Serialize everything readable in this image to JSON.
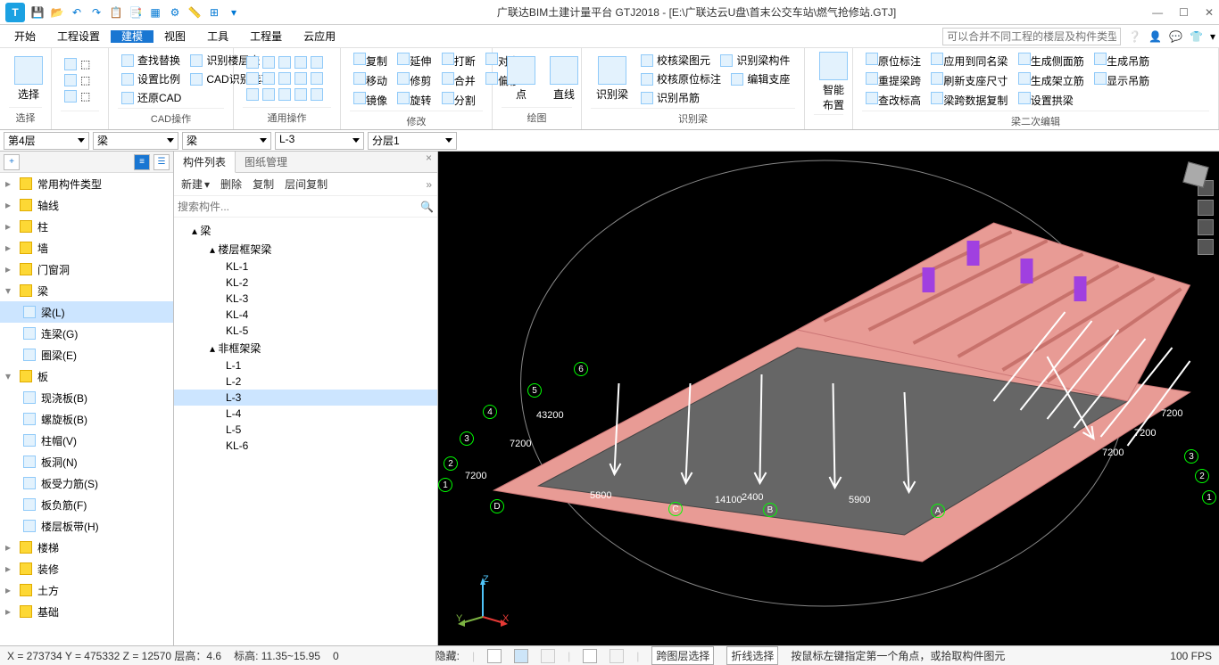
{
  "title": "广联达BIM土建计量平台 GTJ2018 - [E:\\广联达云U盘\\首末公交车站\\燃气抢修站.GTJ]",
  "logo": "T",
  "menu_tabs": [
    "开始",
    "工程设置",
    "建模",
    "视图",
    "工具",
    "工程量",
    "云应用"
  ],
  "menu_active": 2,
  "search_placeholder": "可以合并不同工程的楼层及构件类型吗？",
  "ribbon": {
    "g1": {
      "label": "选择",
      "btns": [
        "选择"
      ]
    },
    "g2": {
      "label": "CAD操作",
      "items": [
        "查找替换",
        "识别楼层表",
        "设置比例",
        "CAD识别选项",
        "还原CAD"
      ]
    },
    "g3": {
      "label": "通用操作"
    },
    "g4": {
      "label": "修改",
      "items": [
        "复制",
        "延伸",
        "打断",
        "对齐",
        "移动",
        "修剪",
        "合并",
        "偏移",
        "镜像",
        "旋转",
        "分割"
      ]
    },
    "g5": {
      "label": "绘图",
      "items": [
        "点",
        "直线"
      ]
    },
    "g6": {
      "label": "识别梁",
      "big": "识别梁",
      "items": [
        "校核梁图元",
        "识别梁构件",
        "校核原位标注",
        "编辑支座",
        "识别吊筋"
      ]
    },
    "g7": {
      "label": "",
      "big": "智能布置"
    },
    "g8": {
      "label": "梁二次编辑",
      "items": [
        "原位标注",
        "应用到同名梁",
        "生成侧面筋",
        "生成吊筋",
        "重提梁跨",
        "刷新支座尺寸",
        "生成架立筋",
        "显示吊筋",
        "查改标高",
        "梁跨数据复制",
        "设置拱梁"
      ]
    }
  },
  "filters": [
    "第4层",
    "梁",
    "梁",
    "L-3",
    "分层1"
  ],
  "tree_cats": [
    "常用构件类型",
    "轴线",
    "柱",
    "墙",
    "门窗洞",
    "梁",
    "板",
    "楼梯",
    "装修",
    "土方",
    "基础"
  ],
  "tree_open_idx": [
    5,
    6
  ],
  "beam_subs": [
    {
      "label": "梁(L)",
      "sel": true
    },
    {
      "label": "连梁(G)"
    },
    {
      "label": "圈梁(E)"
    }
  ],
  "slab_subs": [
    {
      "label": "现浇板(B)"
    },
    {
      "label": "螺旋板(B)"
    },
    {
      "label": "柱帽(V)"
    },
    {
      "label": "板洞(N)"
    },
    {
      "label": "板受力筋(S)"
    },
    {
      "label": "板负筋(F)"
    },
    {
      "label": "楼层板带(H)"
    }
  ],
  "mid_tabs": [
    "构件列表",
    "图纸管理"
  ],
  "mid_tab_active": 0,
  "mid_toolbar": [
    "新建",
    "删除",
    "复制",
    "层间复制"
  ],
  "mid_search_ph": "搜索构件...",
  "mid_tree": {
    "root": "梁",
    "g1": {
      "label": "楼层框架梁",
      "items": [
        "KL-1",
        "KL-2",
        "KL-3",
        "KL-4",
        "KL-5"
      ]
    },
    "g2": {
      "label": "非框架梁",
      "items": [
        "L-1",
        "L-2",
        "L-3",
        "L-4",
        "L-5",
        "KL-6"
      ]
    },
    "sel": "L-3"
  },
  "status": {
    "coords": "X = 273734 Y = 475332 Z = 12570 层高：4.6",
    "elev": "标高: 11.35~15.95",
    "zero": "0",
    "hide": "隐藏:",
    "span_sel": "跨图层选择",
    "poly_sel": "折线选择",
    "hint": "按鼠标左键指定第一个角点，或拾取构件图元",
    "fps": "100 FPS"
  },
  "axis": {
    "x": "X",
    "y": "Y",
    "z": "Z"
  },
  "grids": {
    "num": [
      "1",
      "2",
      "3",
      "4",
      "5",
      "6"
    ],
    "alpha": [
      "A",
      "B",
      "C",
      "D"
    ],
    "dims_left": [
      "7200",
      "7200",
      "43200"
    ],
    "dims_bottom": [
      "5800",
      "14100",
      "2400",
      "5900"
    ],
    "dims_right": [
      "7200",
      "7200",
      "7200"
    ],
    "r_nums": [
      "1",
      "2",
      "3"
    ]
  }
}
